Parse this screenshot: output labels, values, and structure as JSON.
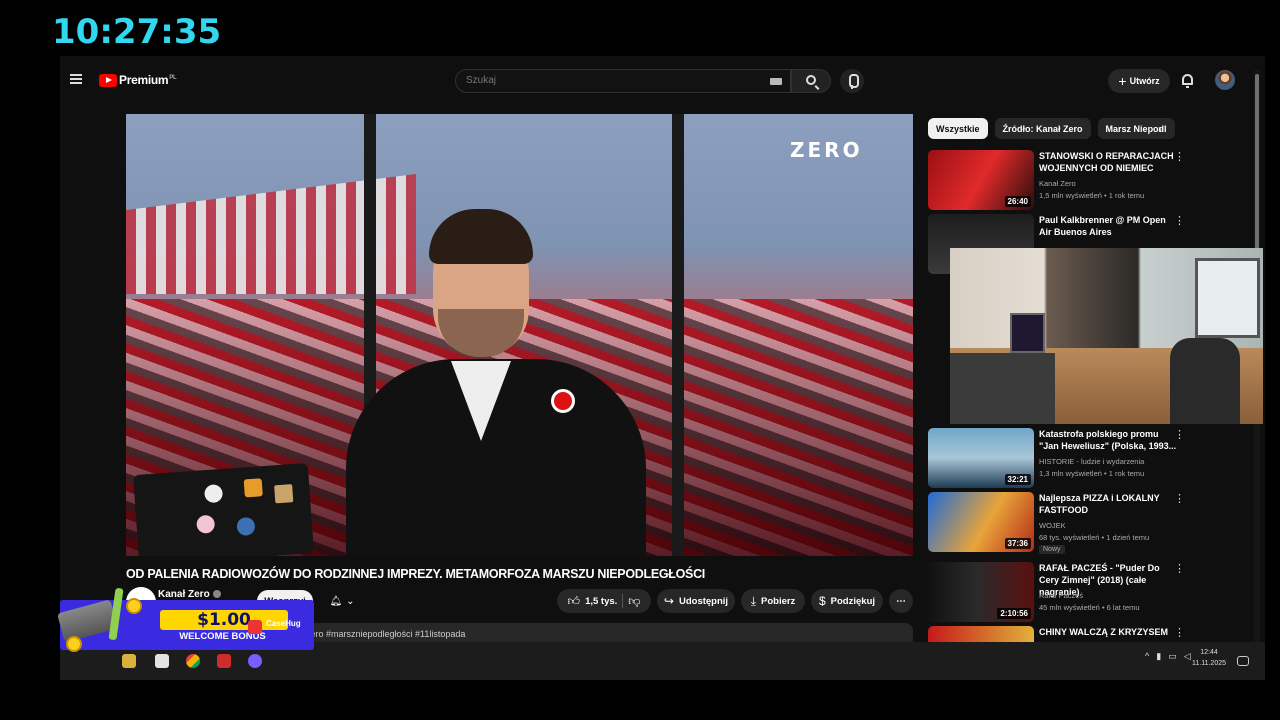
{
  "stream": {
    "clock": "10:27:35"
  },
  "header": {
    "brand": "Premium",
    "brand_region": "PL",
    "search_placeholder": "Szukaj",
    "create_label": "Utwórz"
  },
  "video": {
    "watermark": "ZERO",
    "title": "OD PALENIA RADIOWOZÓW DO RODZINNEJ IMPREZY. METAMORFOZA MARSZU NIEPODLEGŁOŚCI",
    "channel": "Kanał Zero",
    "support_label": "Wesprzyj",
    "likes": "1,5 tys.",
    "share_label": "Udostępnij",
    "download_label": "Pobierz",
    "thanks_label": "Podziękuj",
    "description_snippet": "zero #marszniepodległości #11listopada"
  },
  "sidebar": {
    "chips": [
      "Wszystkie",
      "Źródło: Kanał Zero",
      "Marsz Niepodl"
    ],
    "recommendations": [
      {
        "title": "STANOWSKI O REPARACJACH WOJENNYCH OD NIEMIEC",
        "channel": "Kanał Zero",
        "stats": "1,5 mln wyświetleń • 1 rok temu",
        "duration": "26:40"
      },
      {
        "title": "Paul Kalkbrenner @ PM Open Air Buenos Aires",
        "channel": "",
        "stats": "",
        "duration": ""
      },
      {
        "title": "Katastrofa polskiego promu \"Jan Heweliusz\" (Polska, 1993...",
        "channel": "HISTORIE - ludzie i wydarzenia",
        "stats": "1,3 mln wyświetleń • 1 rok temu",
        "duration": "32:21"
      },
      {
        "title": "Najlepsza PIZZA i LOKALNY FASTFOOD",
        "channel": "WOJEK",
        "stats": "68 tys. wyświetleń • 1 dzień temu",
        "duration": "37:36",
        "badge": "Nowy"
      },
      {
        "title": "RAFAŁ PACZEŚ - \"Puder Do Cery Zimnej\" (2018) (całe nagranie)",
        "channel": "Rafał Pacześ",
        "stats": "45 mln wyświetleń • 6 lat temu",
        "duration": "2:10:56"
      },
      {
        "title": "CHINY WALCZĄ Z KRYZYSEM",
        "channel": "",
        "stats": "",
        "duration": ""
      }
    ]
  },
  "taskbar": {
    "time": "12:44",
    "date": "11.11.2025"
  },
  "ad": {
    "amount": "$1.00",
    "text": "WELCOME BONUS",
    "brand": "CaseHug"
  }
}
